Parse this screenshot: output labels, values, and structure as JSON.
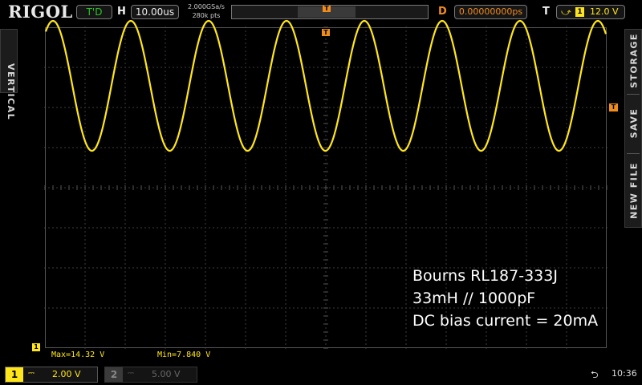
{
  "brand": {
    "logo": "RIGOL"
  },
  "header": {
    "run_mode": "T'D",
    "horizontal_label": "H",
    "timebase": "10.00us",
    "sample_rate": "2.000GSa/s",
    "memory_depth": "280k pts",
    "delay_label": "D",
    "delay_value": "0.00000000ps",
    "trigger_label": "T",
    "trigger_source": "1",
    "trigger_level": "12.0 V"
  },
  "side": {
    "left_tab": "VERTICAL",
    "right_tabs": [
      "STORAGE",
      "SAVE",
      "NEW FILE"
    ]
  },
  "markers": {
    "trigger_marker": "T",
    "channel_marker": "1"
  },
  "measurements": {
    "max": "Max=14.32 V",
    "min": "Min=7.840 V"
  },
  "annotation": {
    "line1": "Bourns RL187-333J",
    "line2": "33mH // 1000pF",
    "line3": "DC bias current = 20mA"
  },
  "channels": [
    {
      "number": "1",
      "coupling": "⎓",
      "scale": "2.00 V",
      "active": true
    },
    {
      "number": "2",
      "coupling": "⎓",
      "scale": "5.00 V",
      "active": false
    }
  ],
  "status": {
    "usb_icon": "usb-icon",
    "clock": "10:36"
  },
  "colors": {
    "ch1": "#ffe61a",
    "trigger": "#f08c1c",
    "grid": "#555555",
    "run": "#28c628"
  },
  "chart_data": {
    "type": "line",
    "signal": "sine",
    "max_v": 14.32,
    "min_v": 7.84,
    "volts_per_div": 2.0,
    "time_per_div_us": 10.0,
    "period_us": 19.4,
    "first_peak_us": 2.0,
    "divisions": {
      "horizontal": 14,
      "vertical": 8
    },
    "center_offset_v": 6.0
  }
}
